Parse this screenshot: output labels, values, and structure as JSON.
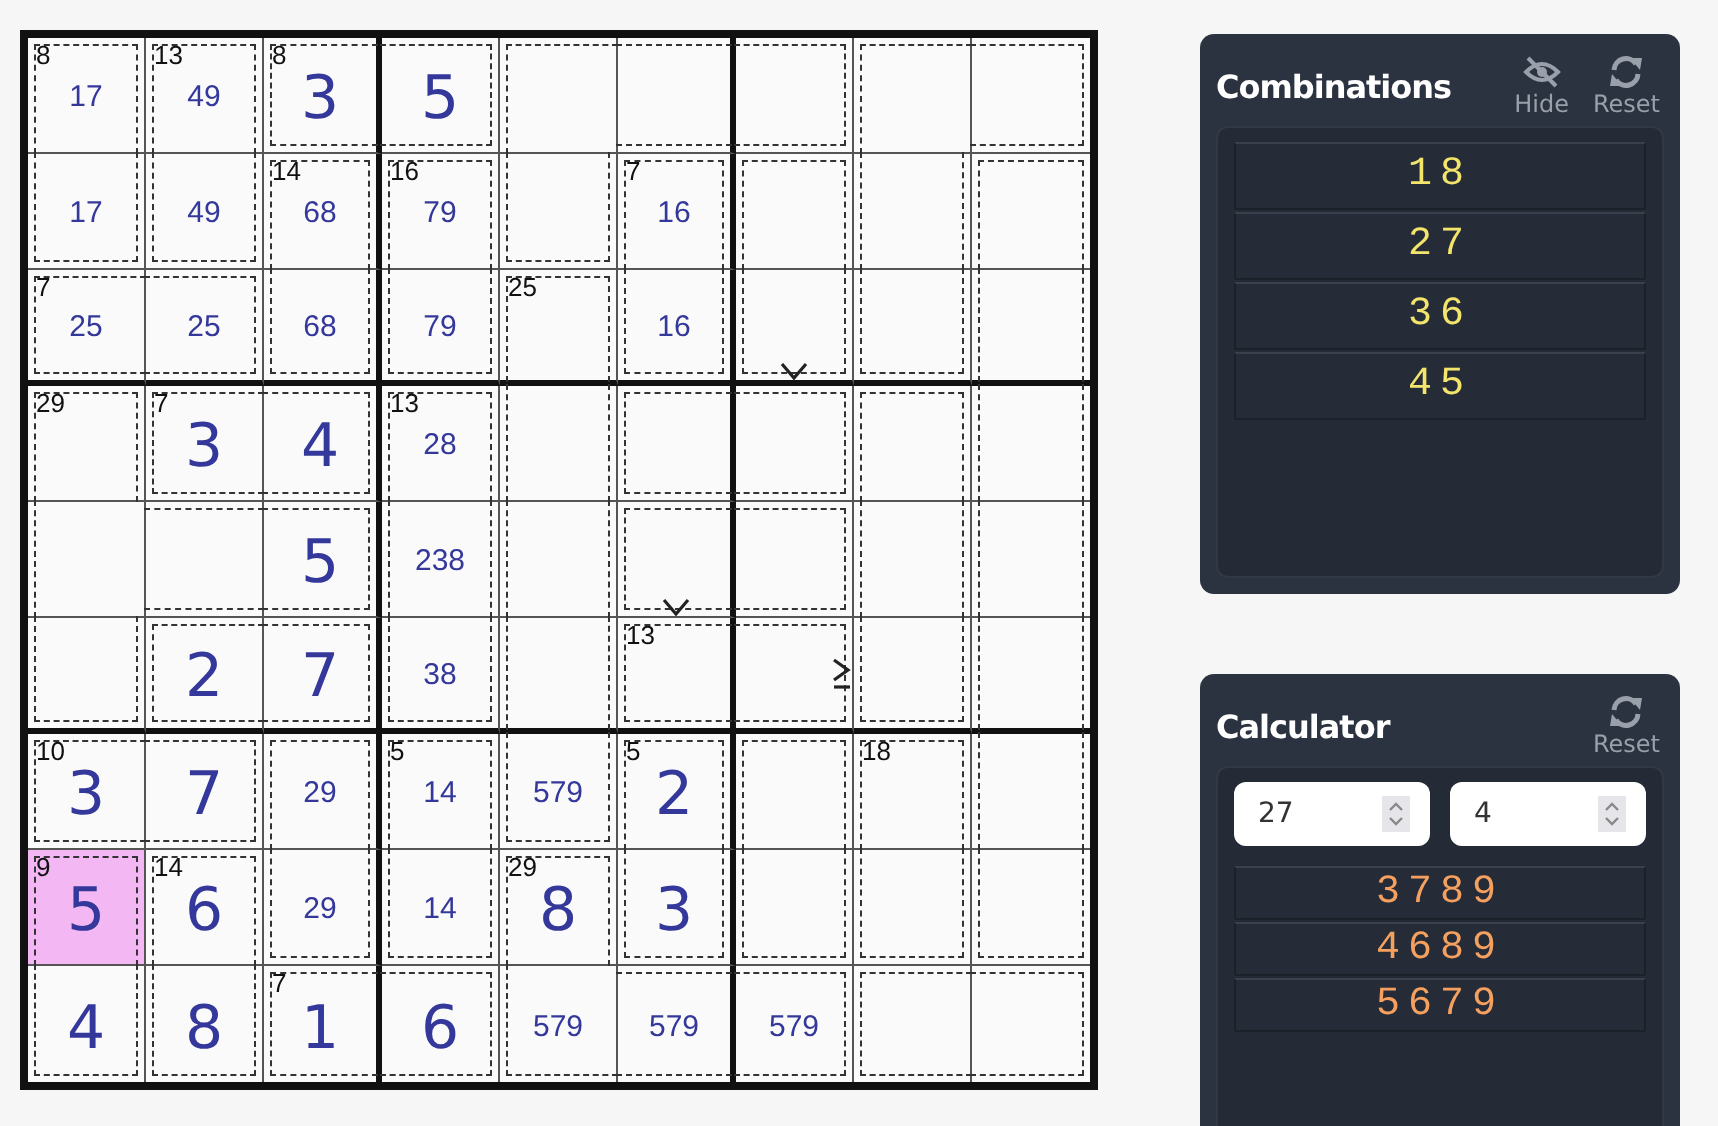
{
  "grid": {
    "rows": [
      [
        {
          "sum": "8",
          "candidates": "17",
          "selected": false,
          "cage": {
            "top": true,
            "bottom": false,
            "left": true,
            "right": true
          }
        },
        {
          "sum": "13",
          "candidates": "49",
          "selected": false,
          "cage": {
            "top": true,
            "bottom": false,
            "left": true,
            "right": true
          }
        },
        {
          "sum": "8",
          "value": "3",
          "selected": false,
          "cage": {
            "top": true,
            "bottom": true,
            "left": true,
            "right": false
          }
        },
        {
          "value": "5",
          "selected": false,
          "cage": {
            "top": true,
            "bottom": true,
            "left": false,
            "right": true
          }
        },
        {
          "selected": false,
          "cage": {
            "top": true,
            "bottom": false,
            "left": true,
            "right": false
          }
        },
        {
          "selected": false,
          "cage": {
            "top": true,
            "bottom": true,
            "left": false,
            "right": false
          }
        },
        {
          "selected": false,
          "cage": {
            "top": true,
            "bottom": true,
            "left": false,
            "right": true
          }
        },
        {
          "selected": false,
          "cage": {
            "top": true,
            "bottom": false,
            "left": true,
            "right": false
          }
        },
        {
          "selected": false,
          "cage": {
            "top": true,
            "bottom": true,
            "left": false,
            "right": true
          }
        }
      ],
      [
        {
          "candidates": "17",
          "selected": false,
          "cage": {
            "top": false,
            "bottom": true,
            "left": true,
            "right": true
          }
        },
        {
          "candidates": "49",
          "selected": false,
          "cage": {
            "top": false,
            "bottom": true,
            "left": true,
            "right": true
          }
        },
        {
          "sum": "14",
          "candidates": "68",
          "selected": false,
          "cage": {
            "top": true,
            "bottom": false,
            "left": true,
            "right": true
          }
        },
        {
          "sum": "16",
          "candidates": "79",
          "selected": false,
          "cage": {
            "top": true,
            "bottom": false,
            "left": true,
            "right": true
          }
        },
        {
          "selected": false,
          "cage": {
            "top": false,
            "bottom": true,
            "left": true,
            "right": true
          }
        },
        {
          "sum": "7",
          "candidates": "16",
          "selected": false,
          "cage": {
            "top": true,
            "bottom": false,
            "left": true,
            "right": true
          }
        },
        {
          "selected": false,
          "cage": {
            "top": true,
            "bottom": false,
            "left": true,
            "right": true
          }
        },
        {
          "selected": false,
          "cage": {
            "top": false,
            "bottom": false,
            "left": true,
            "right": true
          }
        },
        {
          "selected": false,
          "cage": {
            "top": true,
            "bottom": false,
            "left": true,
            "right": true
          }
        }
      ],
      [
        {
          "sum": "7",
          "candidates": "25",
          "selected": false,
          "cage": {
            "top": true,
            "bottom": true,
            "left": true,
            "right": false
          }
        },
        {
          "candidates": "25",
          "selected": false,
          "cage": {
            "top": true,
            "bottom": true,
            "left": false,
            "right": true
          }
        },
        {
          "candidates": "68",
          "selected": false,
          "cage": {
            "top": false,
            "bottom": true,
            "left": true,
            "right": true
          }
        },
        {
          "candidates": "79",
          "selected": false,
          "cage": {
            "top": false,
            "bottom": true,
            "left": true,
            "right": true
          }
        },
        {
          "sum": "25",
          "selected": false,
          "cage": {
            "top": true,
            "bottom": false,
            "left": true,
            "right": true
          }
        },
        {
          "candidates": "16",
          "selected": false,
          "cage": {
            "top": false,
            "bottom": true,
            "left": true,
            "right": true
          }
        },
        {
          "selected": false,
          "mark": {
            "kind": "down"
          },
          "cage": {
            "top": false,
            "bottom": true,
            "left": true,
            "right": true
          }
        },
        {
          "selected": false,
          "cage": {
            "top": false,
            "bottom": true,
            "left": true,
            "right": true
          }
        },
        {
          "selected": false,
          "cage": {
            "top": false,
            "bottom": false,
            "left": true,
            "right": true
          }
        }
      ],
      [
        {
          "sum": "29",
          "selected": false,
          "cage": {
            "top": true,
            "bottom": false,
            "left": true,
            "right": true
          }
        },
        {
          "sum": "7",
          "value": "3",
          "selected": false,
          "cage": {
            "top": true,
            "bottom": true,
            "left": true,
            "right": false
          }
        },
        {
          "value": "4",
          "selected": false,
          "cage": {
            "top": true,
            "bottom": true,
            "left": false,
            "right": true
          }
        },
        {
          "sum": "13",
          "candidates": "28",
          "selected": false,
          "cage": {
            "top": true,
            "bottom": false,
            "left": true,
            "right": true
          }
        },
        {
          "selected": false,
          "cage": {
            "top": false,
            "bottom": false,
            "left": true,
            "right": true
          }
        },
        {
          "selected": false,
          "cage": {
            "top": true,
            "bottom": true,
            "left": true,
            "right": false
          }
        },
        {
          "selected": false,
          "cage": {
            "top": true,
            "bottom": true,
            "left": false,
            "right": true
          }
        },
        {
          "selected": false,
          "cage": {
            "top": true,
            "bottom": false,
            "left": true,
            "right": true
          }
        },
        {
          "selected": false,
          "cage": {
            "top": false,
            "bottom": false,
            "left": true,
            "right": true
          }
        }
      ],
      [
        {
          "selected": false,
          "cage": {
            "top": false,
            "bottom": false,
            "left": true,
            "right": false
          }
        },
        {
          "selected": false,
          "cage": {
            "top": true,
            "bottom": true,
            "left": false,
            "right": false
          }
        },
        {
          "value": "5",
          "selected": false,
          "cage": {
            "top": true,
            "bottom": true,
            "left": false,
            "right": true
          }
        },
        {
          "candidates": "238",
          "selected": false,
          "cage": {
            "top": false,
            "bottom": false,
            "left": true,
            "right": true
          }
        },
        {
          "selected": false,
          "cage": {
            "top": false,
            "bottom": false,
            "left": true,
            "right": true
          }
        },
        {
          "selected": false,
          "mark": {
            "kind": "down"
          },
          "cage": {
            "top": true,
            "bottom": true,
            "left": true,
            "right": false
          }
        },
        {
          "selected": false,
          "cage": {
            "top": true,
            "bottom": true,
            "left": false,
            "right": true
          }
        },
        {
          "selected": false,
          "cage": {
            "top": false,
            "bottom": false,
            "left": true,
            "right": true
          }
        },
        {
          "selected": false,
          "cage": {
            "top": false,
            "bottom": false,
            "left": true,
            "right": true
          }
        }
      ],
      [
        {
          "selected": false,
          "cage": {
            "top": false,
            "bottom": true,
            "left": true,
            "right": true
          }
        },
        {
          "value": "2",
          "selected": false,
          "cage": {
            "top": true,
            "bottom": true,
            "left": true,
            "right": false
          }
        },
        {
          "value": "7",
          "selected": false,
          "cage": {
            "top": true,
            "bottom": true,
            "left": false,
            "right": true
          }
        },
        {
          "candidates": "38",
          "selected": false,
          "cage": {
            "top": false,
            "bottom": true,
            "left": true,
            "right": true
          }
        },
        {
          "selected": false,
          "cage": {
            "top": false,
            "bottom": false,
            "left": true,
            "right": true
          }
        },
        {
          "sum": "13",
          "selected": false,
          "cage": {
            "top": true,
            "bottom": true,
            "left": true,
            "right": false
          }
        },
        {
          "selected": false,
          "mark": {
            "kind": "right-geq"
          },
          "cage": {
            "top": true,
            "bottom": true,
            "left": false,
            "right": true
          }
        },
        {
          "selected": false,
          "cage": {
            "top": false,
            "bottom": true,
            "left": true,
            "right": true
          }
        },
        {
          "selected": false,
          "cage": {
            "top": false,
            "bottom": false,
            "left": true,
            "right": true
          }
        }
      ],
      [
        {
          "sum": "10",
          "value": "3",
          "selected": false,
          "cage": {
            "top": true,
            "bottom": true,
            "left": true,
            "right": false
          }
        },
        {
          "value": "7",
          "selected": false,
          "cage": {
            "top": true,
            "bottom": true,
            "left": false,
            "right": true
          }
        },
        {
          "candidates": "29",
          "selected": false,
          "cage": {
            "top": true,
            "bottom": false,
            "left": true,
            "right": true
          }
        },
        {
          "sum": "5",
          "candidates": "14",
          "selected": false,
          "cage": {
            "top": true,
            "bottom": false,
            "left": true,
            "right": true
          }
        },
        {
          "candidates": "579",
          "selected": false,
          "cage": {
            "top": false,
            "bottom": true,
            "left": true,
            "right": true
          }
        },
        {
          "sum": "5",
          "value": "2",
          "selected": false,
          "cage": {
            "top": true,
            "bottom": false,
            "left": true,
            "right": true
          }
        },
        {
          "selected": false,
          "cage": {
            "top": true,
            "bottom": false,
            "left": true,
            "right": true
          }
        },
        {
          "sum": "18",
          "selected": false,
          "cage": {
            "top": true,
            "bottom": false,
            "left": true,
            "right": true
          }
        },
        {
          "selected": false,
          "cage": {
            "top": false,
            "bottom": false,
            "left": true,
            "right": true
          }
        }
      ],
      [
        {
          "sum": "9",
          "value": "5",
          "selected": true,
          "cage": {
            "top": true,
            "bottom": false,
            "left": true,
            "right": true
          }
        },
        {
          "sum": "14",
          "value": "6",
          "selected": false,
          "cage": {
            "top": true,
            "bottom": false,
            "left": true,
            "right": true
          }
        },
        {
          "candidates": "29",
          "selected": false,
          "cage": {
            "top": false,
            "bottom": true,
            "left": true,
            "right": true
          }
        },
        {
          "candidates": "14",
          "selected": false,
          "cage": {
            "top": false,
            "bottom": true,
            "left": true,
            "right": true
          }
        },
        {
          "sum": "29",
          "value": "8",
          "selected": false,
          "cage": {
            "top": true,
            "bottom": false,
            "left": true,
            "right": true
          }
        },
        {
          "value": "3",
          "selected": false,
          "cage": {
            "top": false,
            "bottom": true,
            "left": true,
            "right": true
          }
        },
        {
          "selected": false,
          "cage": {
            "top": false,
            "bottom": true,
            "left": true,
            "right": true
          }
        },
        {
          "selected": false,
          "cage": {
            "top": false,
            "bottom": true,
            "left": true,
            "right": true
          }
        },
        {
          "selected": false,
          "cage": {
            "top": false,
            "bottom": true,
            "left": true,
            "right": true
          }
        }
      ],
      [
        {
          "value": "4",
          "selected": false,
          "cage": {
            "top": false,
            "bottom": true,
            "left": true,
            "right": true
          }
        },
        {
          "value": "8",
          "selected": false,
          "cage": {
            "top": false,
            "bottom": true,
            "left": true,
            "right": true
          }
        },
        {
          "sum": "7",
          "value": "1",
          "selected": false,
          "cage": {
            "top": true,
            "bottom": true,
            "left": true,
            "right": false
          }
        },
        {
          "value": "6",
          "selected": false,
          "cage": {
            "top": true,
            "bottom": true,
            "left": false,
            "right": true
          }
        },
        {
          "candidates": "579",
          "selected": false,
          "cage": {
            "top": false,
            "bottom": true,
            "left": true,
            "right": false
          }
        },
        {
          "candidates": "579",
          "selected": false,
          "cage": {
            "top": true,
            "bottom": true,
            "left": false,
            "right": false
          }
        },
        {
          "candidates": "579",
          "selected": false,
          "cage": {
            "top": true,
            "bottom": true,
            "left": false,
            "right": true
          }
        },
        {
          "selected": false,
          "cage": {
            "top": true,
            "bottom": true,
            "left": true,
            "right": false
          }
        },
        {
          "selected": false,
          "cage": {
            "top": true,
            "bottom": true,
            "left": false,
            "right": true
          }
        }
      ]
    ]
  },
  "combinations": {
    "title": "Combinations",
    "buttons": [
      {
        "kind": "hide",
        "label": "Hide"
      },
      {
        "kind": "reset",
        "label": "Reset"
      }
    ],
    "items": [
      "18",
      "27",
      "36",
      "45"
    ]
  },
  "calculator": {
    "title": "Calculator",
    "buttons": [
      {
        "kind": "reset",
        "label": "Reset"
      }
    ],
    "inputs": [
      "27",
      "4"
    ],
    "results": [
      "3789",
      "4689",
      "5679"
    ]
  }
}
